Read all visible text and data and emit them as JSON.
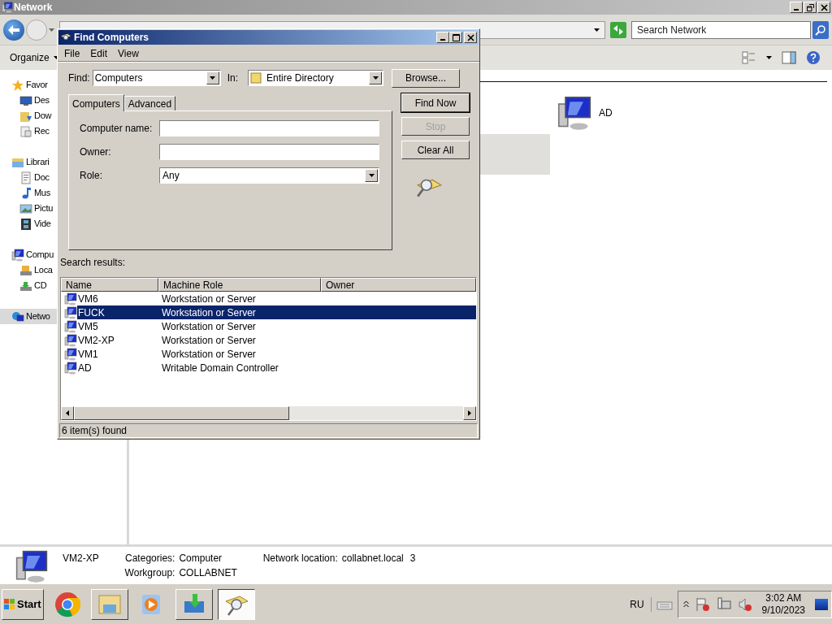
{
  "explorer": {
    "title": "Network",
    "search": {
      "placeholder": "Search Network"
    },
    "organize": "Organize",
    "sidebar": [
      {
        "label": "Favor",
        "kind": "favorites",
        "selected": false,
        "children": [
          {
            "label": "Des",
            "kind": "desktop",
            "selected": false
          },
          {
            "label": "Dow",
            "kind": "downloads",
            "selected": false
          },
          {
            "label": "Rec",
            "kind": "recent",
            "selected": false
          }
        ]
      },
      {
        "label": "Librari",
        "kind": "libraries",
        "selected": false,
        "children": [
          {
            "label": "Doc",
            "kind": "documents",
            "selected": false
          },
          {
            "label": "Mus",
            "kind": "music",
            "selected": false
          },
          {
            "label": "Pictu",
            "kind": "pictures",
            "selected": false
          },
          {
            "label": "Vide",
            "kind": "videos",
            "selected": false
          }
        ]
      },
      {
        "label": "Compu",
        "kind": "computer",
        "selected": false,
        "children": [
          {
            "label": "Loca",
            "kind": "disk",
            "selected": false
          },
          {
            "label": "CD",
            "kind": "cd",
            "selected": false
          }
        ]
      },
      {
        "label": "Netwo",
        "kind": "network",
        "selected": true
      }
    ],
    "items": [
      {
        "label": "AD"
      }
    ],
    "details": {
      "name": "VM2-XP",
      "fields": [
        {
          "label": "Categories:",
          "value": "Computer"
        },
        {
          "label": "Workgroup:",
          "value": "COLLABNET"
        }
      ],
      "location": {
        "label": "Network location:",
        "value": "collabnet.local",
        "extra": "3"
      }
    }
  },
  "dialog": {
    "title": "Find Computers",
    "menu": [
      "File",
      "Edit",
      "View"
    ],
    "find": {
      "label": "Find:",
      "value": "Computers"
    },
    "in": {
      "label": "In:",
      "value": "Entire Directory"
    },
    "browse": "Browse...",
    "tabs": [
      {
        "label": "Computers",
        "selected": true
      },
      {
        "label": "Advanced",
        "selected": false
      }
    ],
    "fields": [
      {
        "kind": "text",
        "label": "Computer name:"
      },
      {
        "kind": "text",
        "label": "Owner:"
      },
      {
        "kind": "select",
        "label": "Role:",
        "value": "Any"
      }
    ],
    "buttons": [
      {
        "label": "Find Now",
        "disabled": false
      },
      {
        "label": "Stop",
        "disabled": true
      },
      {
        "label": "Clear All",
        "disabled": false
      }
    ],
    "results_label": "Search results:",
    "columns": [
      "Name",
      "Machine Role",
      "Owner"
    ],
    "rows": [
      {
        "name": "VM6",
        "role": "Workstation or Server",
        "selected": false
      },
      {
        "name": "FUCK",
        "role": "Workstation or Server",
        "selected": true
      },
      {
        "name": "VM5",
        "role": "Workstation or Server",
        "selected": false
      },
      {
        "name": "VM2-XP",
        "role": "Workstation or Server",
        "selected": false
      },
      {
        "name": "VM1",
        "role": "Workstation or Server",
        "selected": false
      },
      {
        "name": "AD",
        "role": "Writable Domain Controller",
        "selected": false
      }
    ],
    "status": "6 item(s) found"
  },
  "taskbar": {
    "start": "Start",
    "apps": [
      {
        "kind": "browser",
        "running": false,
        "selected": false
      },
      {
        "kind": "explorer",
        "running": true,
        "selected": false
      },
      {
        "kind": "media",
        "running": false,
        "selected": false
      },
      {
        "kind": "installer",
        "running": true,
        "selected": false
      },
      {
        "kind": "search",
        "running": true,
        "selected": true
      }
    ],
    "language": "RU",
    "time": "3:02 AM",
    "date": "9/10/2023"
  }
}
